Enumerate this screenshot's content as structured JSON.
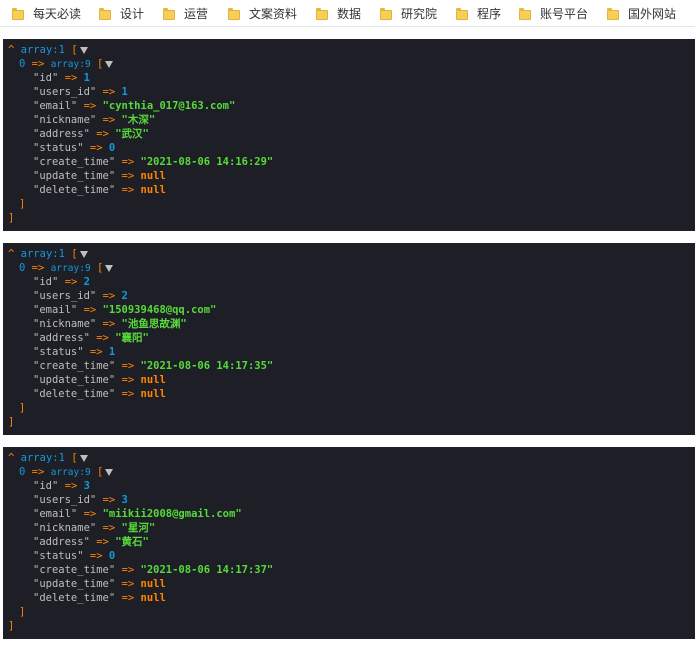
{
  "bookmarks": [
    {
      "label": "每天必读"
    },
    {
      "label": "设计"
    },
    {
      "label": "运营"
    },
    {
      "label": "文案资料"
    },
    {
      "label": "数据"
    },
    {
      "label": "研究院"
    },
    {
      "label": "程序"
    },
    {
      "label": "账号平台"
    },
    {
      "label": "国外网站"
    }
  ],
  "dumps": [
    {
      "outer_label": "array:1",
      "inner_index": "0",
      "inner_label": "array:9",
      "fields": [
        {
          "key": "\"id\"",
          "value": "1",
          "kind": "num"
        },
        {
          "key": "\"users_id\"",
          "value": "1",
          "kind": "num"
        },
        {
          "key": "\"email\"",
          "value": "\"cynthia_017@163.com\"",
          "kind": "str"
        },
        {
          "key": "\"nickname\"",
          "value": "\"木深\"",
          "kind": "str"
        },
        {
          "key": "\"address\"",
          "value": "\"武汉\"",
          "kind": "str"
        },
        {
          "key": "\"status\"",
          "value": "0",
          "kind": "num"
        },
        {
          "key": "\"create_time\"",
          "value": "\"2021-08-06 14:16:29\"",
          "kind": "str"
        },
        {
          "key": "\"update_time\"",
          "value": "null",
          "kind": "nul"
        },
        {
          "key": "\"delete_time\"",
          "value": "null",
          "kind": "nul"
        }
      ]
    },
    {
      "outer_label": "array:1",
      "inner_index": "0",
      "inner_label": "array:9",
      "fields": [
        {
          "key": "\"id\"",
          "value": "2",
          "kind": "num"
        },
        {
          "key": "\"users_id\"",
          "value": "2",
          "kind": "num"
        },
        {
          "key": "\"email\"",
          "value": "\"150939468@qq.com\"",
          "kind": "str"
        },
        {
          "key": "\"nickname\"",
          "value": "\"池鱼思故渊\"",
          "kind": "str"
        },
        {
          "key": "\"address\"",
          "value": "\"襄阳\"",
          "kind": "str"
        },
        {
          "key": "\"status\"",
          "value": "1",
          "kind": "num"
        },
        {
          "key": "\"create_time\"",
          "value": "\"2021-08-06 14:17:35\"",
          "kind": "str"
        },
        {
          "key": "\"update_time\"",
          "value": "null",
          "kind": "nul"
        },
        {
          "key": "\"delete_time\"",
          "value": "null",
          "kind": "nul"
        }
      ]
    },
    {
      "outer_label": "array:1",
      "inner_index": "0",
      "inner_label": "array:9",
      "fields": [
        {
          "key": "\"id\"",
          "value": "3",
          "kind": "num"
        },
        {
          "key": "\"users_id\"",
          "value": "3",
          "kind": "num"
        },
        {
          "key": "\"email\"",
          "value": "\"miikii2008@gmail.com\"",
          "kind": "str"
        },
        {
          "key": "\"nickname\"",
          "value": "\"星河\"",
          "kind": "str"
        },
        {
          "key": "\"address\"",
          "value": "\"黄石\"",
          "kind": "str"
        },
        {
          "key": "\"status\"",
          "value": "0",
          "kind": "num"
        },
        {
          "key": "\"create_time\"",
          "value": "\"2021-08-06 14:17:37\"",
          "kind": "str"
        },
        {
          "key": "\"update_time\"",
          "value": "null",
          "kind": "nul"
        },
        {
          "key": "\"delete_time\"",
          "value": "null",
          "kind": "nul"
        }
      ]
    }
  ],
  "syntax": {
    "caret": "^",
    "arrow": "=>",
    "open_bracket": "[",
    "close_bracket": "]"
  },
  "colors": {
    "panel_bg": "#1e1e26",
    "orange": "#ff8400",
    "blue": "#1299da",
    "green": "#56db3a",
    "key_gray": "#bfbfbf"
  }
}
